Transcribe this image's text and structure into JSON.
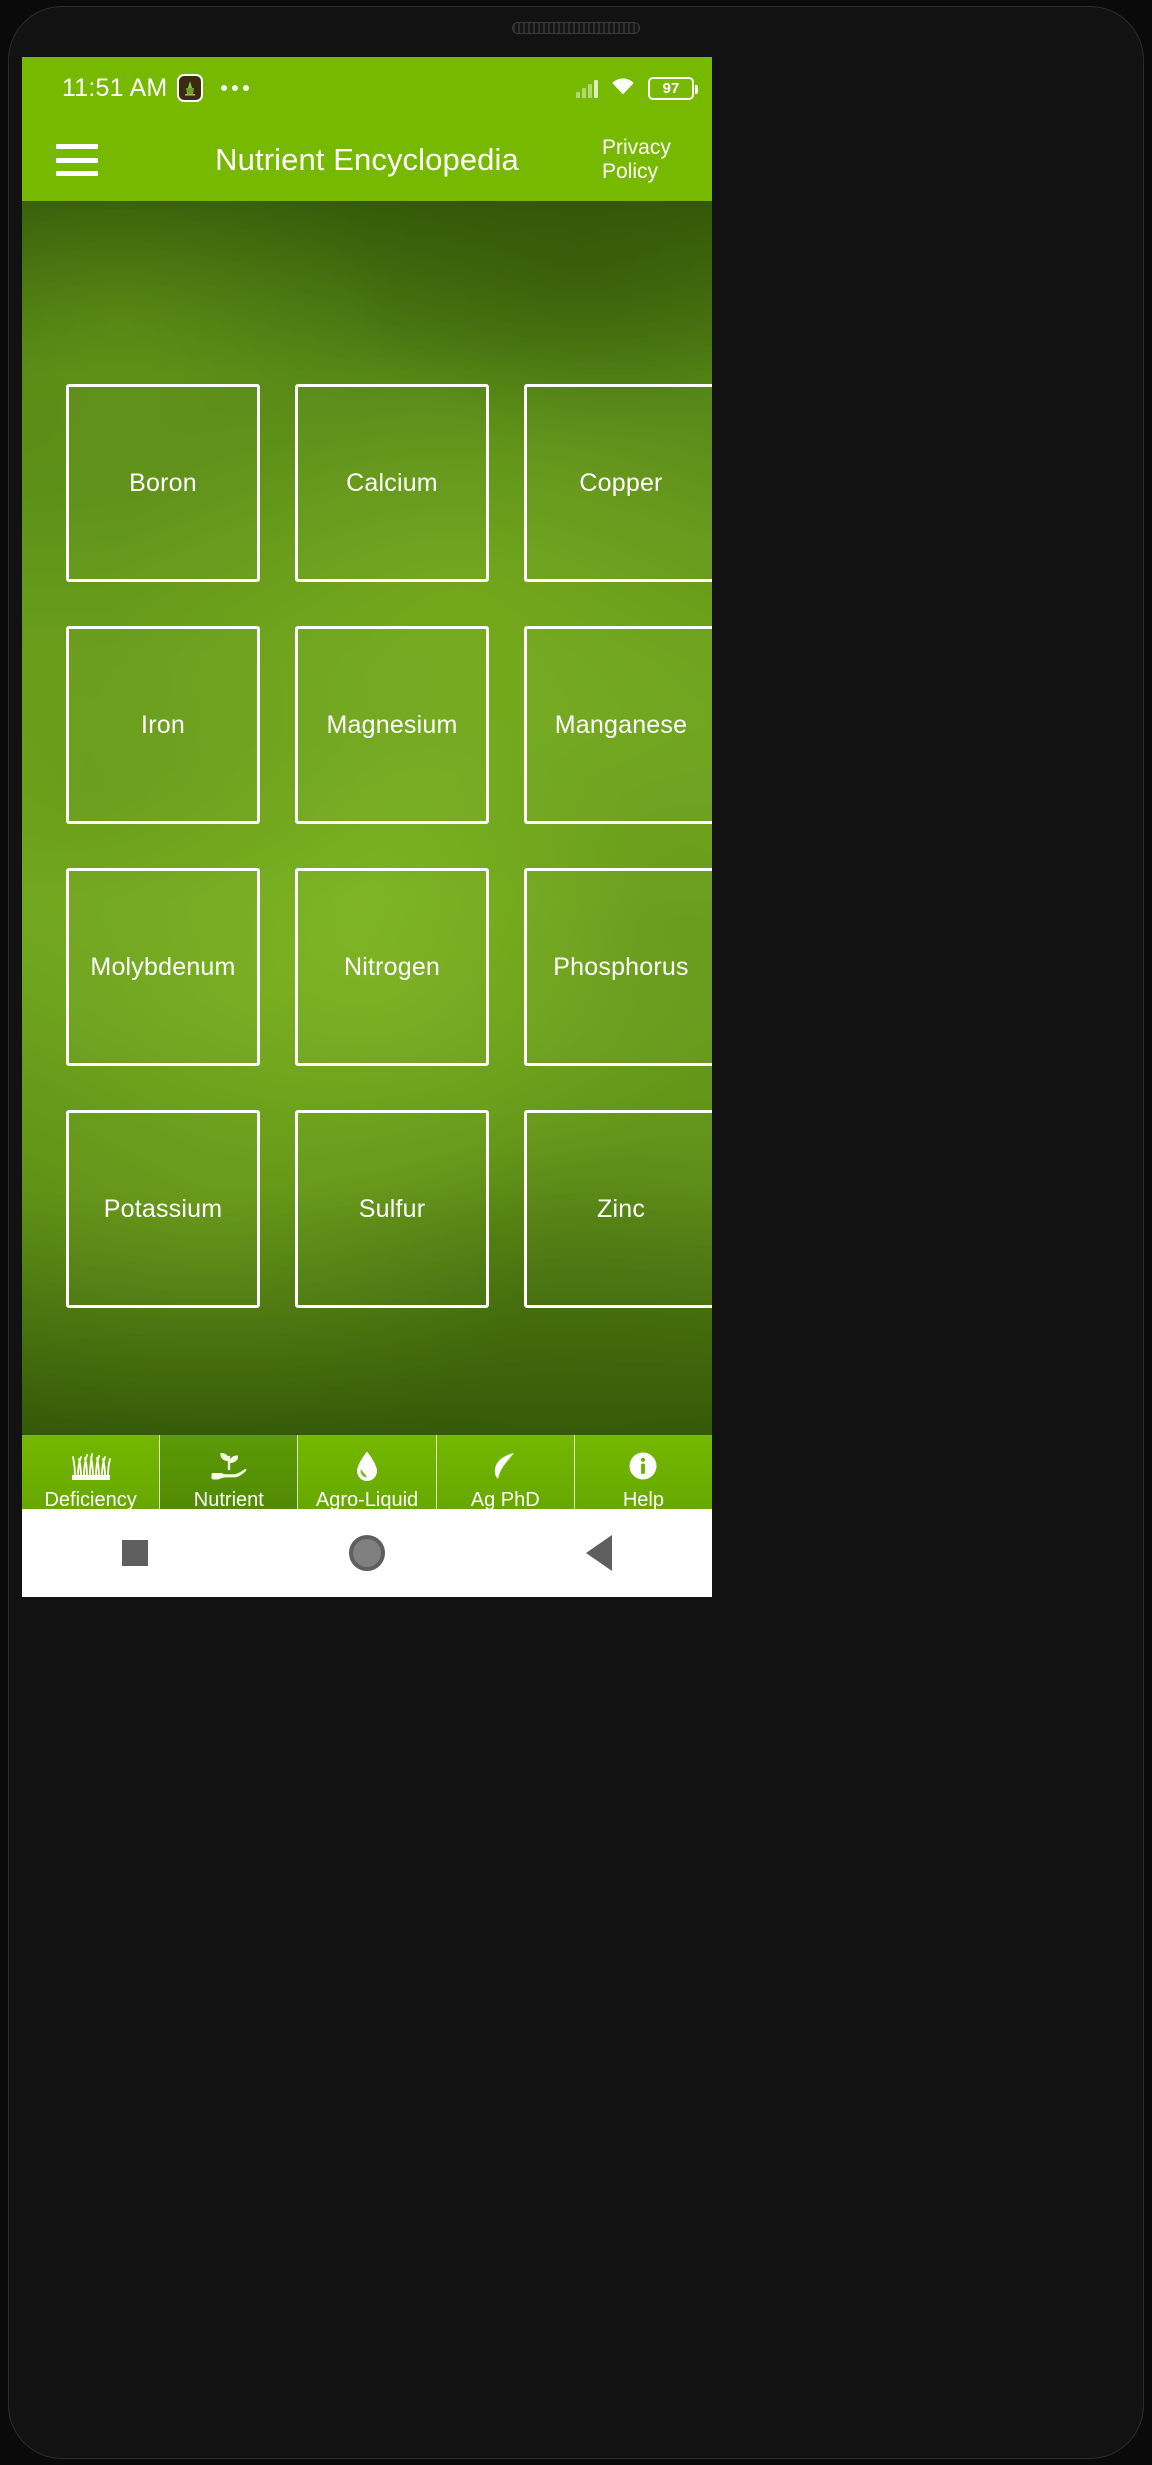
{
  "status_bar": {
    "time": "11:51 AM",
    "app_icon": "app-notification-icon",
    "overflow_icon": "more-dots-icon",
    "signal_icon": "cellular-signal-icon",
    "wifi_icon": "wifi-icon",
    "battery_icon": "battery-icon",
    "battery_level": "97"
  },
  "header": {
    "menu_icon": "hamburger-menu-icon",
    "title": "Nutrient Encyclopedia",
    "privacy_policy_line1": "Privacy",
    "privacy_policy_line2": "Policy",
    "background_color": "#76b900"
  },
  "main": {
    "nutrients": [
      {
        "name": "Boron"
      },
      {
        "name": "Calcium"
      },
      {
        "name": "Copper"
      },
      {
        "name": "Iron"
      },
      {
        "name": "Magnesium"
      },
      {
        "name": "Manganese"
      },
      {
        "name": "Molybdenum"
      },
      {
        "name": "Nitrogen"
      },
      {
        "name": "Phosphorus"
      },
      {
        "name": "Potassium"
      },
      {
        "name": "Sulfur"
      },
      {
        "name": "Zinc"
      }
    ]
  },
  "tab_bar": {
    "tabs": [
      {
        "label": "Deficiency",
        "icon": "grass-icon",
        "active": false
      },
      {
        "label": "Nutrient",
        "icon": "seedling-hand-icon",
        "active": true
      },
      {
        "label": "Agro-Liquid",
        "icon": "water-drop-icon",
        "active": false
      },
      {
        "label": "Ag PhD",
        "icon": "leaf-icon",
        "active": false
      },
      {
        "label": "Help",
        "icon": "info-circle-icon",
        "active": false
      }
    ]
  },
  "nav_bar": {
    "recents_icon": "square-recents-icon",
    "home_icon": "circle-home-icon",
    "back_icon": "triangle-back-icon"
  }
}
